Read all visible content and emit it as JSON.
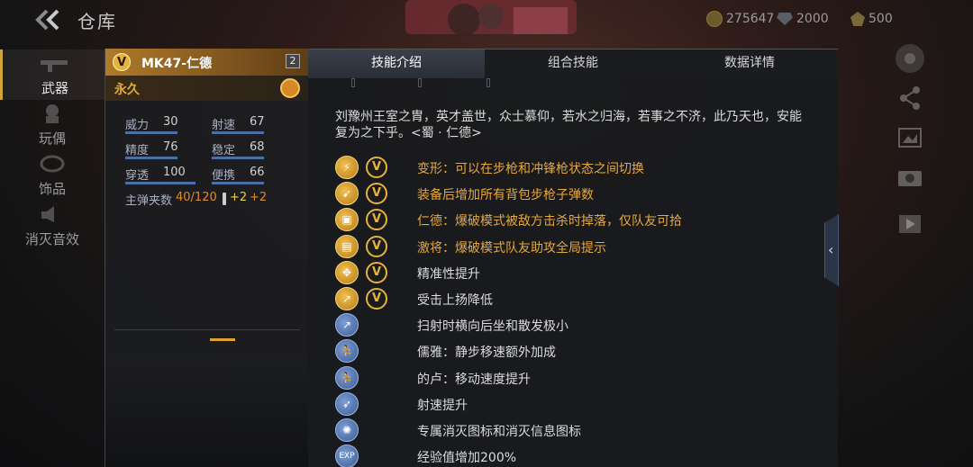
{
  "header": {
    "title": "仓库",
    "currencies": [
      {
        "icon": "coin-icon",
        "value": "275647"
      },
      {
        "icon": "gem-icon",
        "value": "2000"
      },
      {
        "icon": "medal-icon",
        "value": "500"
      }
    ]
  },
  "nav": {
    "items": [
      {
        "label": "武器",
        "icon": "rifle-icon",
        "active": true
      },
      {
        "label": "玩偶",
        "icon": "doll-icon",
        "active": false
      },
      {
        "label": "饰品",
        "icon": "ornament-icon",
        "active": false
      },
      {
        "label": "消灭音效",
        "icon": "sound-icon",
        "active": false
      }
    ]
  },
  "weapon": {
    "badge": "V",
    "name": "MK47-仁德",
    "level": "2",
    "permanence": "永久",
    "stats": [
      {
        "name": "威力",
        "value": "30"
      },
      {
        "name": "射速",
        "value": "67"
      },
      {
        "name": "精度",
        "value": "76"
      },
      {
        "name": "稳定",
        "value": "68"
      },
      {
        "name": "穿透",
        "value": "100"
      },
      {
        "name": "便携",
        "value": "66"
      }
    ],
    "magazine_label": "主弹夹数",
    "magazine_value": "40/120",
    "magazine_bonus1": "+2",
    "magazine_bonus2": "+2"
  },
  "tabs": [
    {
      "label": "技能介绍",
      "active": true
    },
    {
      "label": "组合技能",
      "active": false
    },
    {
      "label": "数据详情",
      "active": false
    }
  ],
  "description": "刘豫州王室之胄，英才盖世，众士慕仰，若水之归海，若事之不济，此乃天也，安能复为之下乎。<蜀 · 仁德>",
  "perks": [
    {
      "icon": "transform-icon",
      "style": "gold",
      "glyph": "⚡",
      "v": true,
      "text": "变形：可以在步枪和冲锋枪状态之间切换",
      "color": "gold"
    },
    {
      "icon": "ammo-icon",
      "style": "gold",
      "glyph": "➹",
      "v": true,
      "text": "装备后增加所有背包步枪子弹数",
      "color": "gold"
    },
    {
      "icon": "gift-icon",
      "style": "gold",
      "glyph": "▣",
      "v": true,
      "text": "仁德：爆破模式被敌方击杀时掉落，仅队友可拾",
      "color": "gold"
    },
    {
      "icon": "rally-icon",
      "style": "gold",
      "glyph": "▤",
      "v": true,
      "text": "激将：爆破模式队友助攻全局提示",
      "color": "gold"
    },
    {
      "icon": "precision-icon",
      "style": "gold",
      "glyph": "✥",
      "v": true,
      "text": "精准性提升",
      "color": "white"
    },
    {
      "icon": "recoil-icon",
      "style": "gold",
      "glyph": "↗",
      "v": true,
      "text": "受击上扬降低",
      "color": "white"
    },
    {
      "icon": "spray-icon",
      "style": "blue",
      "glyph": "↗",
      "v": false,
      "text": "扫射时横向后坐和散发极小",
      "color": "white"
    },
    {
      "icon": "walk-icon",
      "style": "blue",
      "glyph": "⛹",
      "v": false,
      "text": "儒雅：静步移速额外加成",
      "color": "white"
    },
    {
      "icon": "run-icon",
      "style": "blue",
      "glyph": "⛹",
      "v": false,
      "text": "的卢：移动速度提升",
      "color": "white"
    },
    {
      "icon": "bullet-icon",
      "style": "blue",
      "glyph": "➶",
      "v": false,
      "text": "射速提升",
      "color": "white"
    },
    {
      "icon": "kill-emblem-icon",
      "style": "blue",
      "glyph": "✺",
      "v": false,
      "text": "专属消灭图标和消灭信息图标",
      "color": "white"
    },
    {
      "icon": "exp-icon",
      "style": "blue",
      "glyph": "EXP",
      "v": false,
      "text": "经验值增加200%",
      "color": "white"
    }
  ]
}
